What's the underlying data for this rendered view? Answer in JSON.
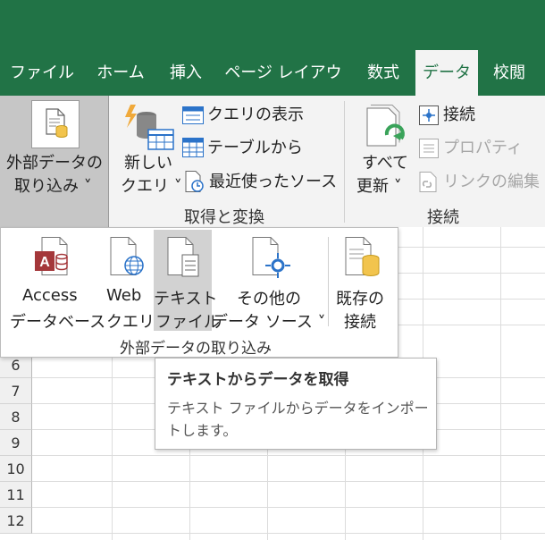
{
  "tabs": [
    {
      "label": "ファイル"
    },
    {
      "label": "ホーム"
    },
    {
      "label": "挿入"
    },
    {
      "label": "ページ レイアウト"
    },
    {
      "label": "数式"
    },
    {
      "label": "データ",
      "active": true
    },
    {
      "label": "校閲"
    }
  ],
  "ribbon": {
    "external_data": {
      "line1": "外部データの",
      "line2": "取り込み ˅"
    },
    "new_query": {
      "line1": "新しい",
      "line2": "クエリ ˅"
    },
    "show_queries": "クエリの表示",
    "from_table": "テーブルから",
    "recent_sources": "最近使ったソース",
    "get_transform_group": "取得と変換",
    "refresh_all": {
      "line1": "すべて",
      "line2": "更新 ˅"
    },
    "connections": "接続",
    "properties": "プロパティ",
    "edit_links": "リンクの編集",
    "connections_group": "接続"
  },
  "dropdown": {
    "items": [
      {
        "line1": "Access",
        "line2": "データベース"
      },
      {
        "line1": "Web",
        "line2": "クエリ"
      },
      {
        "line1": "テキスト",
        "line2": "ファイル"
      },
      {
        "line1": "その他の",
        "line2": "データ ソース ˅"
      },
      {
        "line1": "既存の",
        "line2": "接続"
      }
    ],
    "group_label": "外部データの取り込み"
  },
  "tooltip": {
    "title": "テキストからデータを取得",
    "body": "テキスト ファイルからデータをインポートします。"
  },
  "rows": [
    "6",
    "7",
    "8",
    "9",
    "10",
    "11",
    "12"
  ],
  "colors": {
    "excel_green": "#217346",
    "ribbon_bg": "#f3f3f3",
    "access_red": "#a4373a",
    "link_blue": "#2b73c9"
  }
}
